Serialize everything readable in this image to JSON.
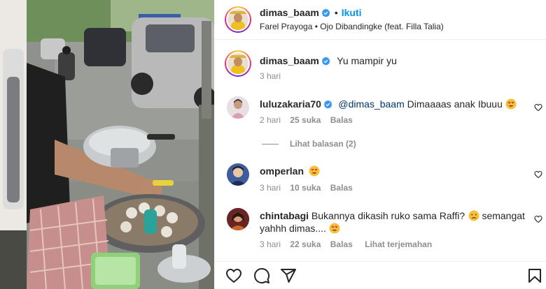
{
  "post": {
    "username": "dimas_baam",
    "follow_label": "Ikuti",
    "separator": "•",
    "song": "Farel Prayoga • Ojo Dibandingke (feat. Filla Talia)",
    "caption": "Yu mampir yu",
    "caption_time": "3 hari"
  },
  "comments": [
    {
      "username": "luluzakaria70",
      "mention": "@dimas_baam",
      "text": " Dimaaaas anak Ibuuu",
      "emoji": "heart-eyes",
      "time": "2 hari",
      "likes": "25 suka",
      "reply": "Balas",
      "view_replies": "Lihat balasan (2)"
    },
    {
      "username": "omperlan",
      "text": "",
      "emoji": "heart-eyes",
      "time": "3 hari",
      "likes": "10 suka",
      "reply": "Balas"
    },
    {
      "username": "chintabagi",
      "text": " Bukannya dikasih ruko sama Raffi?",
      "text2a": " semangat",
      "text2b": "yahhh dimas....",
      "emoji1": "disappointed",
      "emoji2": "heart-eyes",
      "time": "3 hari",
      "likes": "22 suka",
      "reply": "Balas",
      "translate": "Lihat terjemahan"
    }
  ],
  "icons": [
    "verified-icon",
    "heart-icon",
    "comment-icon",
    "share-icon",
    "bookmark-icon"
  ],
  "colors": {
    "link_blue": "#0095f6",
    "verified_blue": "#3897f0",
    "meta_gray": "#8e8e8e",
    "text": "#262626"
  }
}
